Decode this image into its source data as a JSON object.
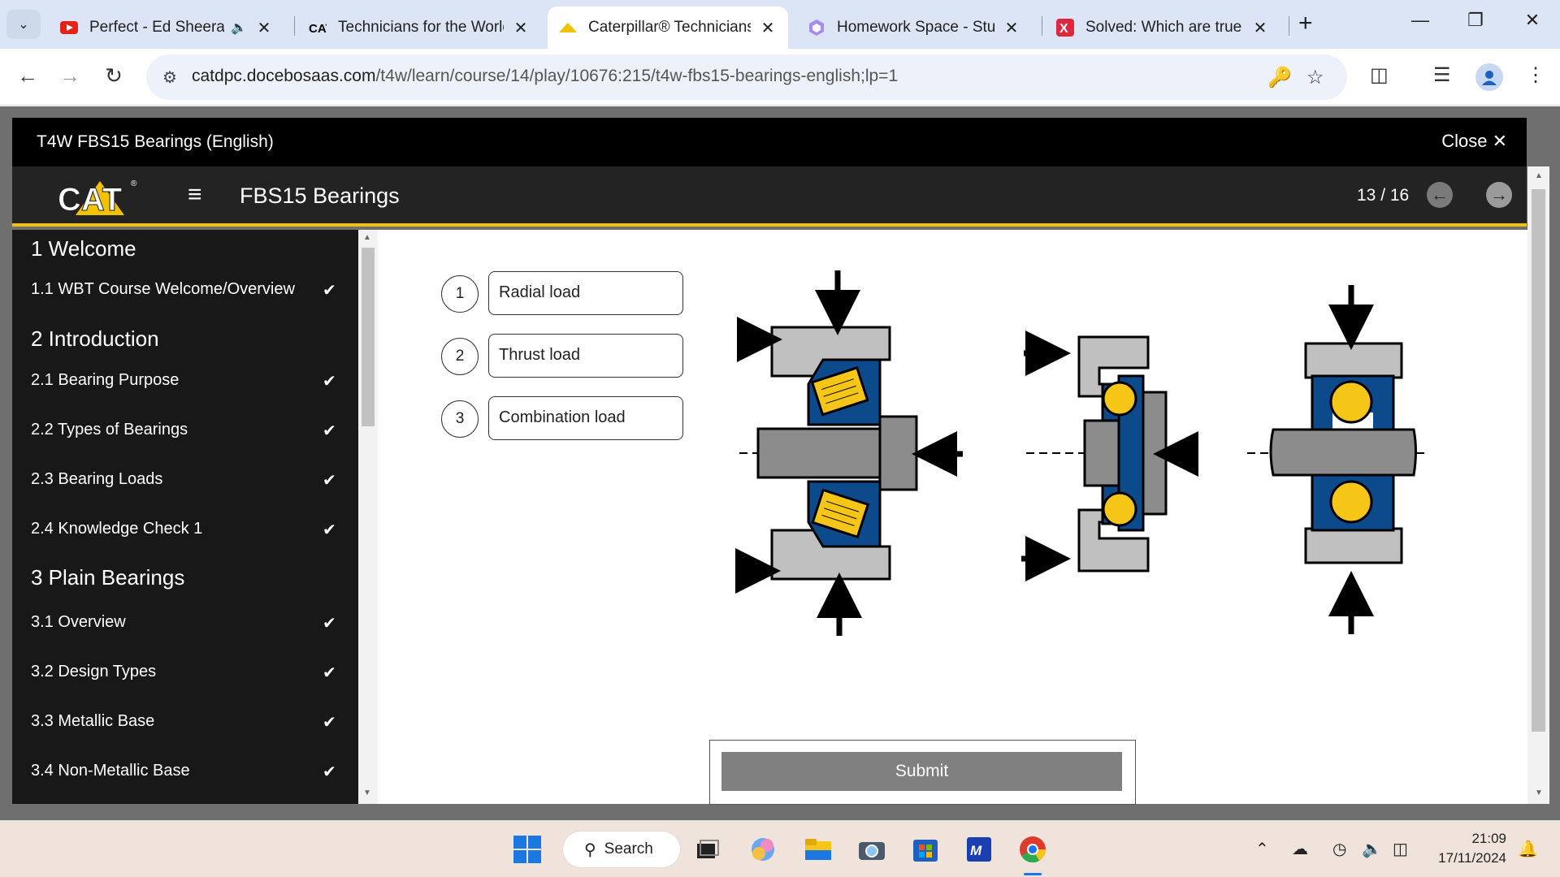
{
  "browser": {
    "tabs": [
      {
        "title": "Perfect - Ed Sheeran (",
        "active": false
      },
      {
        "title": "Technicians for the World",
        "active": false
      },
      {
        "title": "Caterpillar® Technicians",
        "active": true
      },
      {
        "title": "Homework Space - Study",
        "active": false
      },
      {
        "title": "Solved: Which are true st",
        "active": false
      }
    ],
    "url_domain": "catdpc.docebosaas.com",
    "url_path": "/t4w/learn/course/14/play/10676:215/t4w-fbs15-bearings-english;lp=1"
  },
  "course": {
    "header_title": "T4W FBS15 Bearings (English)",
    "close_label": "Close",
    "module_title": "FBS15 Bearings",
    "page_counter": "13 / 16"
  },
  "sidebar": {
    "rows": [
      {
        "type": "section",
        "label": "1 Welcome"
      },
      {
        "type": "item",
        "label": "1.1 WBT Course Welcome/Overview",
        "done": true
      },
      {
        "type": "section",
        "label": "2 Introduction"
      },
      {
        "type": "item",
        "label": "2.1 Bearing Purpose",
        "done": true
      },
      {
        "type": "item",
        "label": "2.2 Types of Bearings",
        "done": true
      },
      {
        "type": "item",
        "label": "2.3 Bearing Loads",
        "done": true
      },
      {
        "type": "item",
        "label": "2.4 Knowledge Check 1",
        "done": true
      },
      {
        "type": "section",
        "label": "3 Plain Bearings"
      },
      {
        "type": "item",
        "label": "3.1 Overview",
        "done": true
      },
      {
        "type": "item",
        "label": "3.2 Design Types",
        "done": true
      },
      {
        "type": "item",
        "label": "3.3 Metallic Base",
        "done": true
      },
      {
        "type": "item",
        "label": "3.4 Non-Metallic Base",
        "done": true
      }
    ]
  },
  "question": {
    "options": [
      {
        "number": "1",
        "label": "Radial load"
      },
      {
        "number": "2",
        "label": "Thrust load"
      },
      {
        "number": "3",
        "label": "Combination load"
      }
    ],
    "submit_label": "Submit"
  },
  "taskbar": {
    "search_label": "Search",
    "time": "21:09",
    "date": "17/11/2024"
  },
  "colors": {
    "accent": "#f2c200",
    "bearing_blue": "#0d4a8c",
    "roller_yellow": "#f5c518",
    "race_gray": "#bfbfbf"
  }
}
